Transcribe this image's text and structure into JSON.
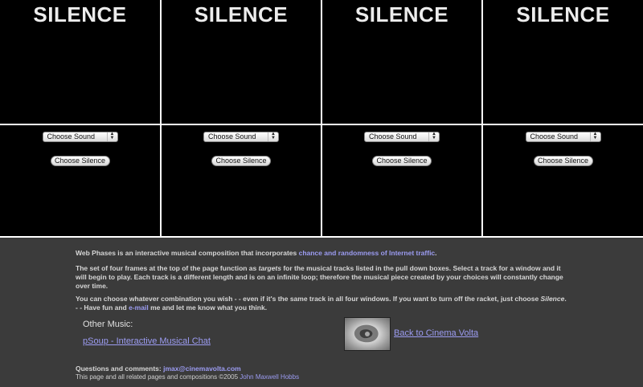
{
  "frames": [
    {
      "title": "SILENCE",
      "select_label": "Choose Sound",
      "button_label": "Choose Silence"
    },
    {
      "title": "SILENCE",
      "select_label": "Choose Sound",
      "button_label": "Choose Silence"
    },
    {
      "title": "SILENCE",
      "select_label": "Choose Sound",
      "button_label": "Choose Silence"
    },
    {
      "title": "SILENCE",
      "select_label": "Choose Sound",
      "button_label": "Choose Silence"
    }
  ],
  "intro": {
    "text": "Web Phases is an interactive musical composition that incorporates ",
    "link": "chance and randomness of Internet traffic",
    "end": "."
  },
  "targets": {
    "pre": "The set of four frames at the top of the page function as ",
    "em": "targets",
    "post": " for the musical tracks listed in the pull down boxes. Select a track for a window and it will begin to play. Each track is a different length and is on an infinite loop; therefore the musical piece created by your choices will constantly change over time."
  },
  "combo": {
    "pre": "You can choose whatever combination you wish - - even if it's the same track in all four windows. If you want to turn off the racket, just choose ",
    "em": "Silence",
    "mid": ". - - Have fun and ",
    "link": "e-mail",
    "post": " me and let me know what you think."
  },
  "other": {
    "heading": "Other Music:",
    "link": "pSoup - Interactive Musical Chat"
  },
  "back": {
    "link": "Back to Cinema Volta"
  },
  "footer": {
    "questions": "Questions and comments: ",
    "email": "jmax@cinemavolta.com",
    "copyright": "This page and all related pages and compositions ©2005 ",
    "author": "John Maxwell Hobbs"
  }
}
